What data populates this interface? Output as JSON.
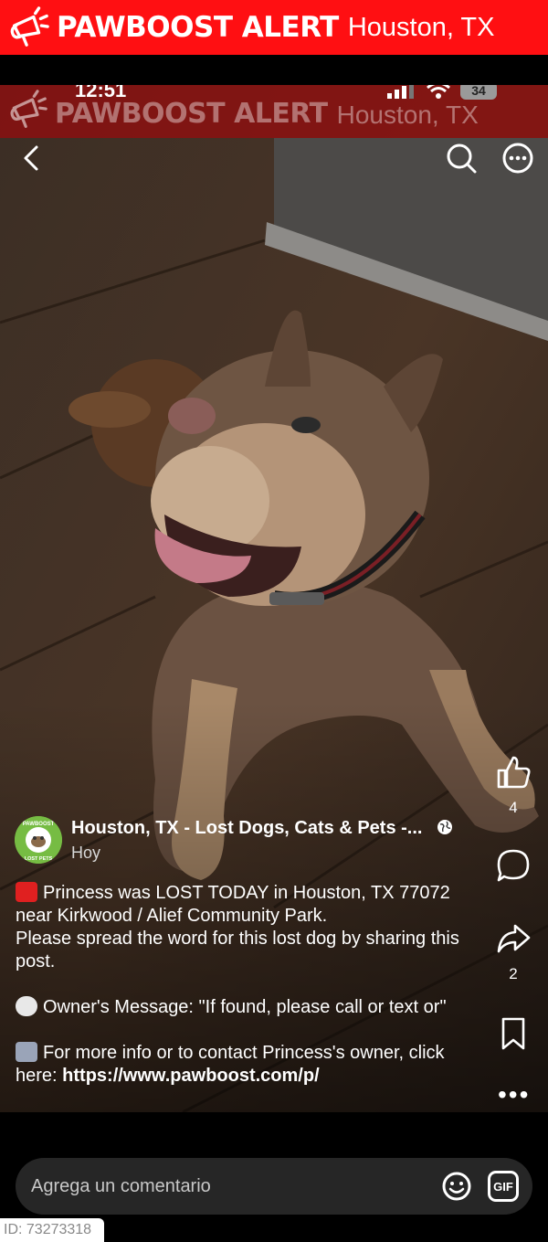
{
  "alert_banner": {
    "brand": "PAWBOOST ALERT",
    "city": "Houston, TX",
    "icon": "megaphone-icon",
    "color": "#ff0f12"
  },
  "status_bar": {
    "time": "12:51",
    "battery": "34"
  },
  "post": {
    "author": "Houston, TX - Lost Dogs, Cats & Pets -...",
    "avatar_text_top": "PAWBOOST",
    "avatar_text_bottom": "LOST PETS",
    "time": "Hoy",
    "likes": "4",
    "shares": "2",
    "caption": {
      "line1": "Princess was LOST TODAY in Houston, TX 77072 near Kirkwood / Alief Community Park.",
      "line2": "Please spread the word for this lost dog by sharing this post.",
      "owner_message": "Owner's Message: \"If found, please call or text or\"",
      "more_info": "For more info or to contact Princess's owner, click here: ",
      "link": "https://www.pawboost.com/p/"
    }
  },
  "comment_bar": {
    "placeholder": "Agrega un comentario",
    "gif_label": "GIF"
  },
  "id_label": "ID: 73273318"
}
